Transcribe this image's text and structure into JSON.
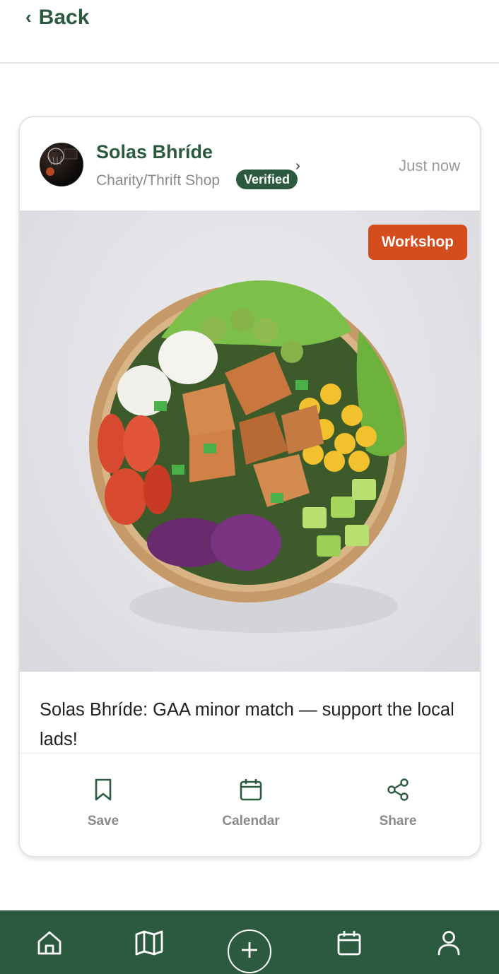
{
  "header": {
    "back_label": "Back"
  },
  "post": {
    "org_name": "Solas Bhríde",
    "org_type": "Charity/Thrift Shop",
    "verified_label": "Verified",
    "time": "Just now",
    "tag": "Workshop",
    "caption": "Solas Bhríde: GAA minor match — support the local lads!",
    "photo_alt": "salad bowl"
  },
  "actions": [
    {
      "label": "Save",
      "icon": "bookmark-icon"
    },
    {
      "label": "Calendar",
      "icon": "calendar-icon"
    },
    {
      "label": "Share",
      "icon": "share-icon"
    }
  ],
  "bottom_nav": [
    {
      "icon": "home-icon"
    },
    {
      "icon": "map-icon"
    },
    {
      "icon": "plus-circle-icon"
    },
    {
      "icon": "calendar-icon"
    },
    {
      "icon": "profile-icon"
    }
  ],
  "colors": {
    "brand": "#2c5a3f",
    "tag": "#d54d1d",
    "muted": "#8a8a8a"
  }
}
